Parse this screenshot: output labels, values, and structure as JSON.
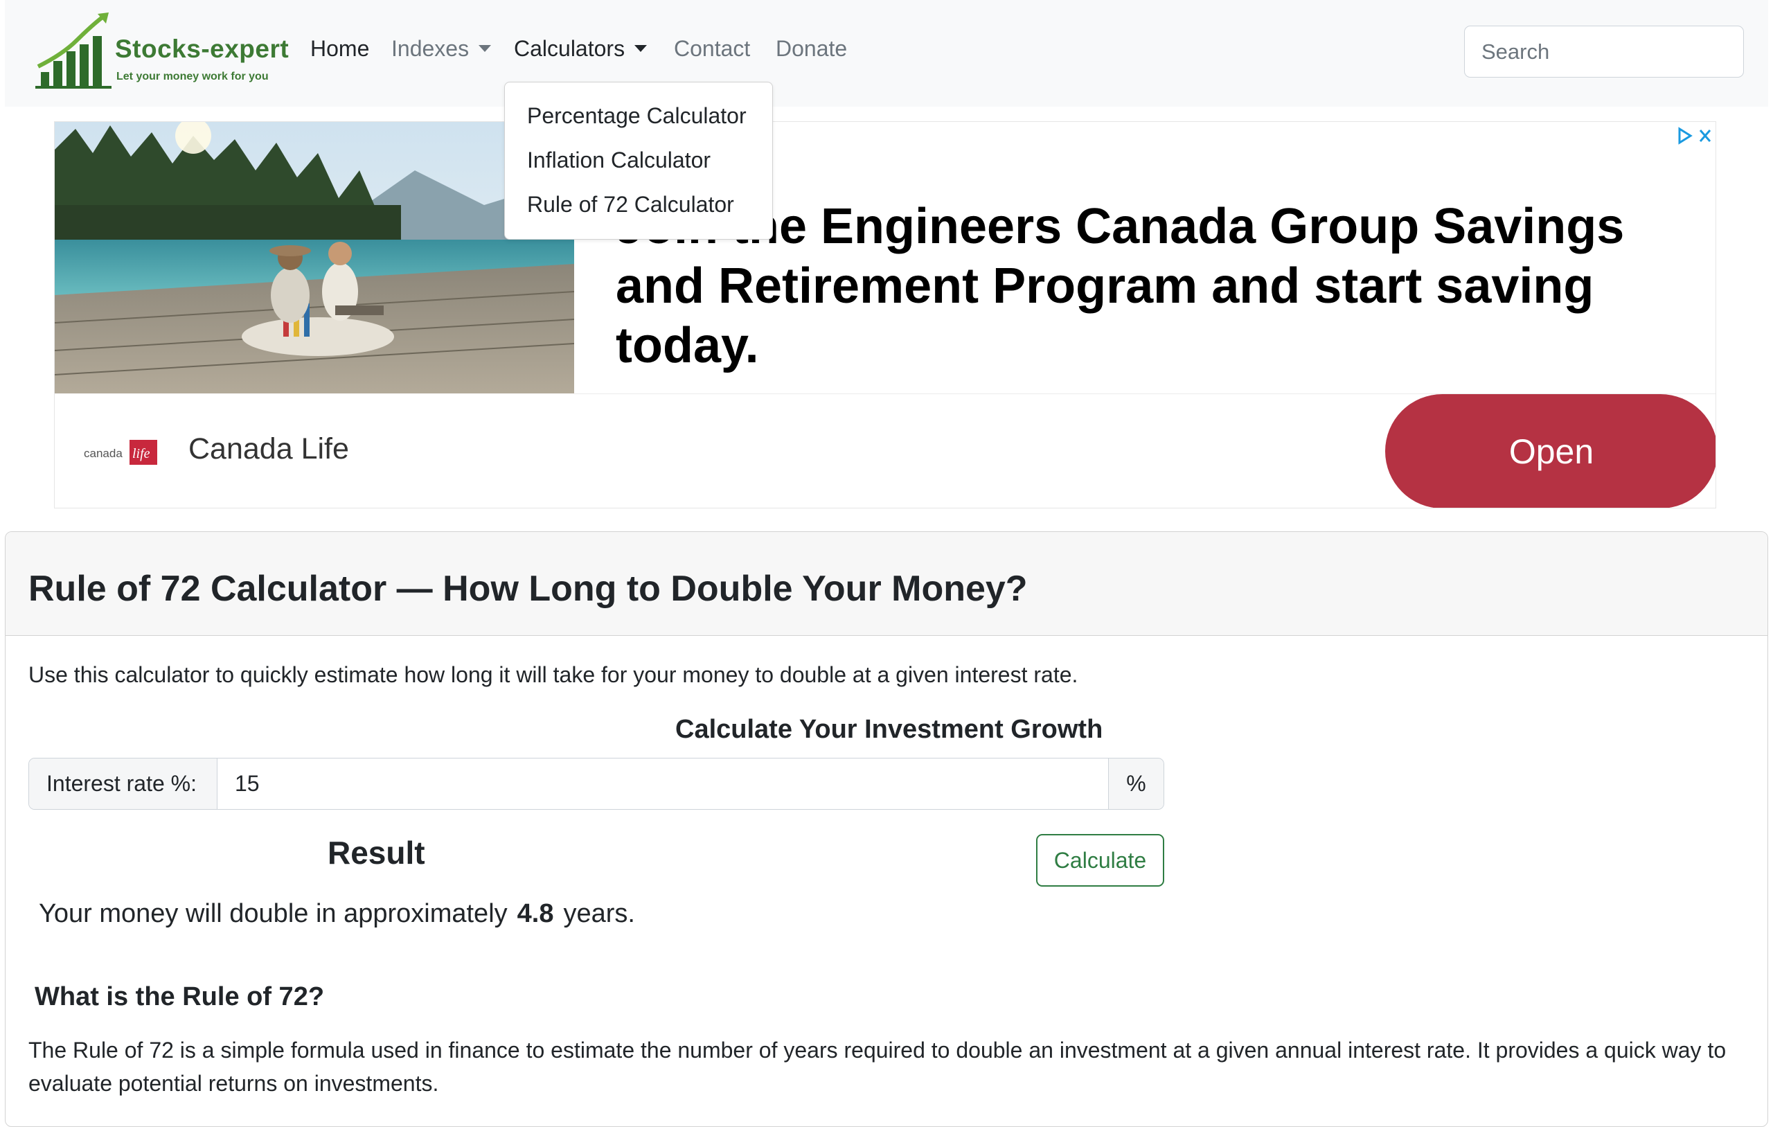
{
  "navbar": {
    "logo": {
      "title": "Stocks-expert",
      "tagline": "Let your money work for you"
    },
    "items": [
      {
        "label": "Home",
        "active": true
      },
      {
        "label": "Indexes",
        "dropdown": true
      },
      {
        "label": "Calculators",
        "dropdown": true,
        "open": true
      },
      {
        "label": "Contact"
      },
      {
        "label": "Donate"
      }
    ],
    "search_placeholder": "Search"
  },
  "calculators_menu": {
    "items": [
      "Percentage Calculator",
      "Inflation Calculator",
      "Rule of 72 Calculator"
    ]
  },
  "ad": {
    "headline": "Join the Engineers Canada Group Savings and Retirement Program and start saving today.",
    "brand_logo_text": "canada life",
    "brand": "Canada Life",
    "cta": "Open",
    "cta_color": "#b53243"
  },
  "calculator": {
    "title": "Rule of 72 Calculator — How Long to Double Your Money?",
    "intro": "Use this calculator to quickly estimate how long it will take for your money to double at a given interest rate.",
    "subtitle": "Calculate Your Investment Growth",
    "rate_label": "Interest rate %:",
    "rate_value": "15",
    "rate_suffix": "%",
    "result_title": "Result",
    "calculate_label": "Calculate",
    "result_prefix": "Your money will double in approximately",
    "result_value": "4.8",
    "result_suffix": "years.",
    "accent_color": "#2f7d43"
  },
  "explainer": {
    "title": "What is the Rule of 72?",
    "text": "The Rule of 72 is a simple formula used in finance to estimate the number of years required to double an investment at a given annual interest rate. It provides a quick way to evaluate potential returns on investments."
  }
}
